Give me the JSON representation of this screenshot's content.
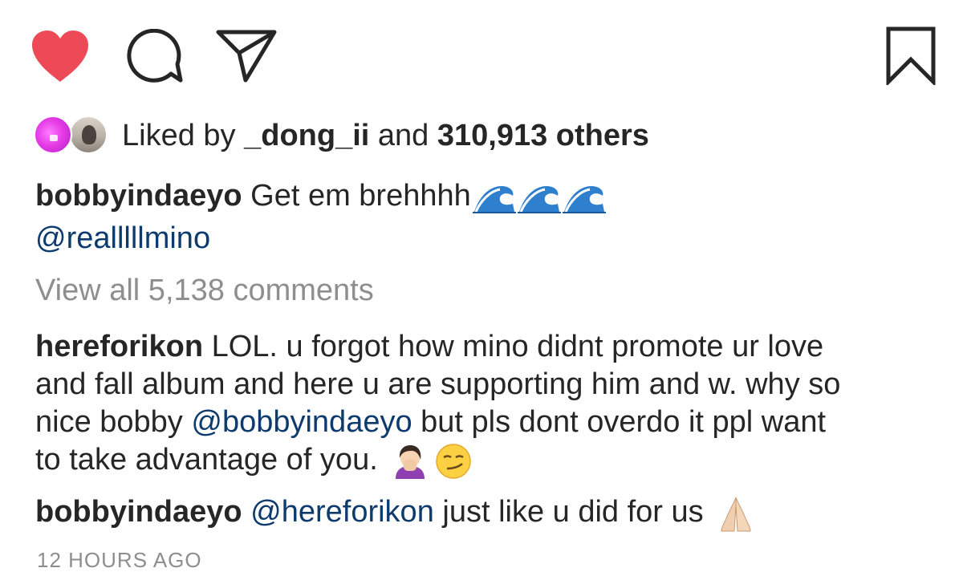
{
  "actions": {
    "like_icon": "heart-filled-icon",
    "comment_icon": "speech-bubble-icon",
    "share_icon": "paper-plane-icon",
    "save_icon": "bookmark-icon",
    "like_color": "#ed4956"
  },
  "likes": {
    "prefix": "Liked by ",
    "user": "_dong_ii",
    "joiner": " and ",
    "count_text": "310,913 others"
  },
  "caption": {
    "username": "bobbyindaeyo",
    "text": " Get em brehhhh",
    "emojis": [
      "wave-emoji",
      "wave-emoji",
      "wave-emoji"
    ],
    "mention": "@realllllmino"
  },
  "view_all": "View all 5,138 comments",
  "comments": [
    {
      "username": "hereforikon",
      "lines": [
        " LOL. u forgot how mino didnt promote ur love",
        "and fall album and here u are supporting him and w. why so",
        "nice bobby ",
        " but pls dont overdo it ppl want",
        "to take advantage of you. "
      ],
      "mention": "@bobbyindaeyo",
      "emojis": [
        "facepalm-woman-emoji",
        "smirk-emoji"
      ]
    },
    {
      "username": "bobbyindaeyo",
      "mention": "@hereforikon",
      "text": " just like u did for us ",
      "emojis": [
        "folded-hands-emoji"
      ]
    }
  ],
  "timestamp": "12 HOURS AGO"
}
